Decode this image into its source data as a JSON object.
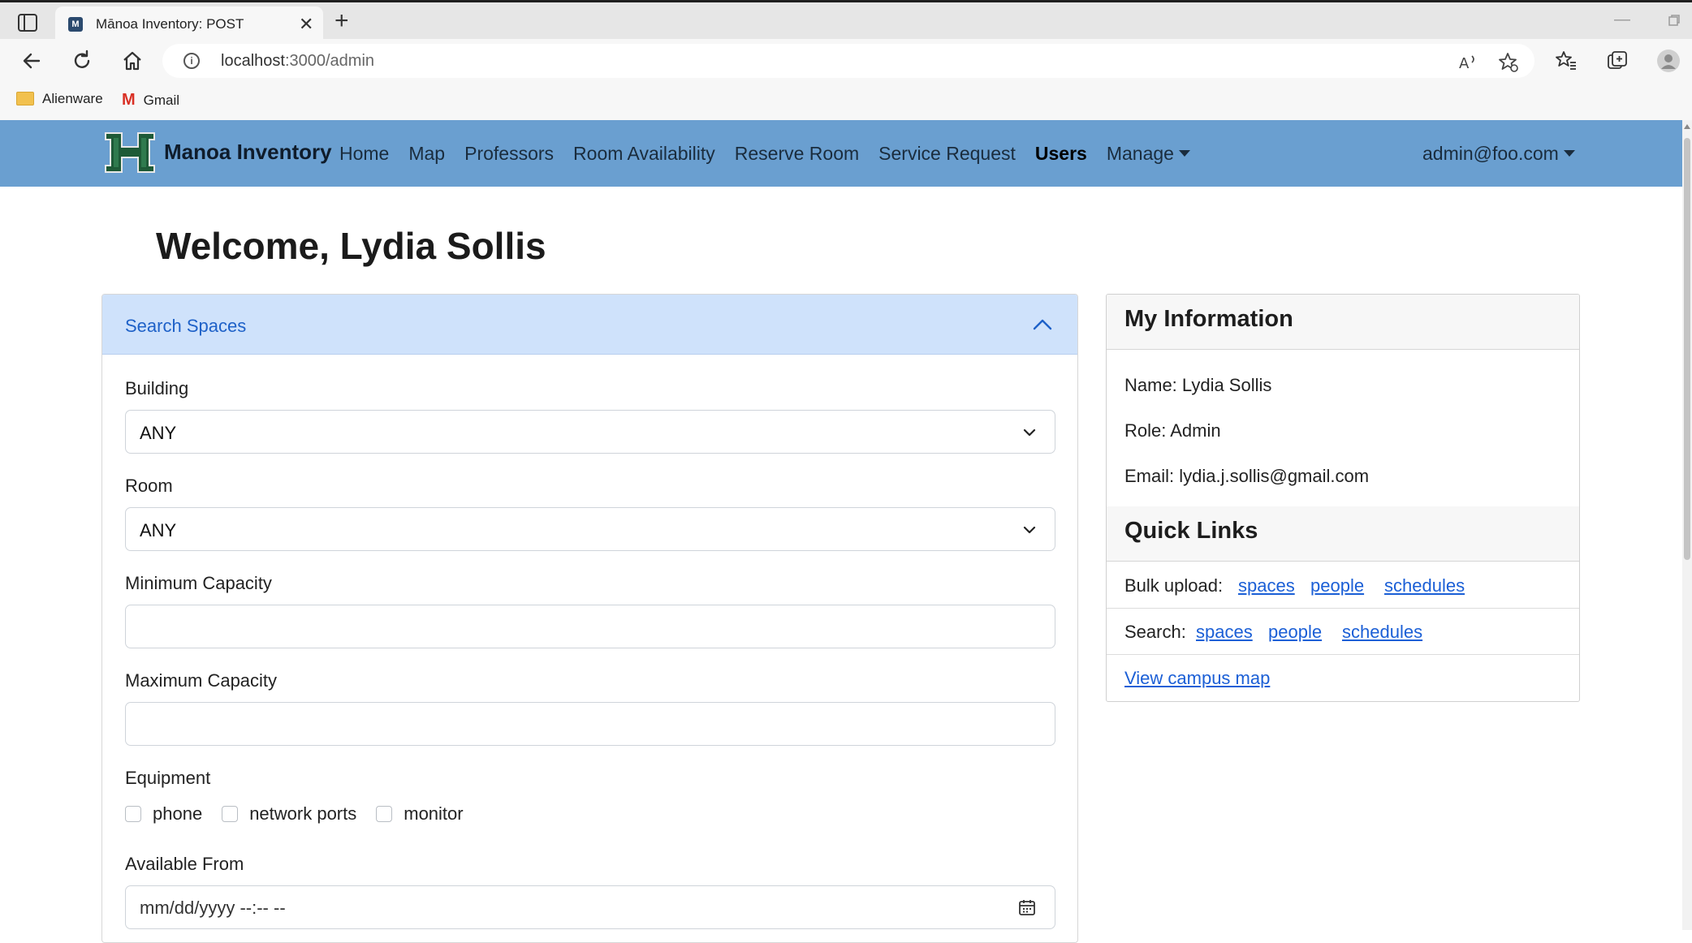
{
  "browser": {
    "tab_title": "Mānoa Inventory: POST",
    "url_host": "localhost",
    "url_path": ":3000/admin",
    "bookmarks": [
      "Alienware",
      "Gmail"
    ]
  },
  "navbar": {
    "brand": "Manoa Inventory",
    "links": [
      "Home",
      "Map",
      "Professors",
      "Room Availability",
      "Reserve Room",
      "Service Request",
      "Users",
      "Manage"
    ],
    "user": "admin@foo.com",
    "bg_color": "#6a9fd0"
  },
  "main": {
    "welcome": "Welcome, Lydia Sollis",
    "search": {
      "header": "Search Spaces",
      "building_label": "Building",
      "building_value": "ANY",
      "room_label": "Room",
      "room_value": "ANY",
      "min_cap_label": "Minimum Capacity",
      "min_cap_value": "",
      "max_cap_label": "Maximum Capacity",
      "max_cap_value": "",
      "equipment_label": "Equipment",
      "equipment": [
        "phone",
        "network ports",
        "monitor"
      ],
      "available_from_label": "Available From",
      "available_from_placeholder": "mm/dd/yyyy --:-- --"
    },
    "info": {
      "title": "My Information",
      "name": "Name: Lydia Sollis",
      "role": "Role: Admin",
      "email": "Email: lydia.j.sollis@gmail.com"
    },
    "quick_links": {
      "title": "Quick Links",
      "bulk_label": "Bulk upload:",
      "bulk_links": [
        "spaces",
        "people",
        "schedules"
      ],
      "search_label": "Search:",
      "search_links": [
        "spaces",
        "people",
        "schedules"
      ],
      "map_link": "View campus map"
    }
  }
}
